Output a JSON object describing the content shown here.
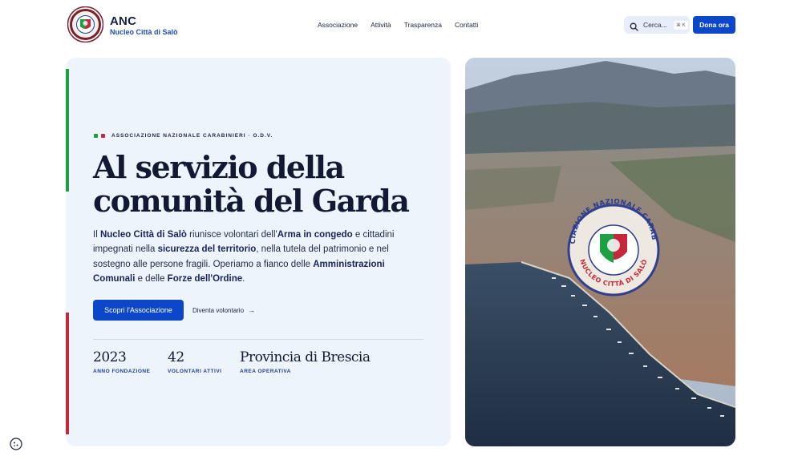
{
  "header": {
    "brand_title": "ANC",
    "brand_subtitle": "Nucleo Città di Salò",
    "nav": [
      "Associazione",
      "Attività",
      "Trasparenza",
      "Contatti"
    ],
    "search_placeholder": "Cerca...",
    "search_shortcut": "⌘ K",
    "donate_label": "Dona ora"
  },
  "hero": {
    "eyebrow": "ASSOCIAZIONE NAZIONALE CARABINIERI · O.D.V.",
    "headline_line1": "Al servizio della",
    "headline_line2": "comunità del Garda",
    "body": {
      "t1": "Il ",
      "b1": "Nucleo Città di Salò",
      "t2": " riunisce volontari dell'",
      "b2": "Arma in congedo",
      "t3": " e cittadini impegnati nella ",
      "b3": "sicurezza del territorio",
      "t4": ", nella tutela del patrimonio e nel sostegno alle persone fragili. Operiamo a fianco delle ",
      "b4": "Amministrazioni Comunali",
      "t5": " e delle ",
      "b5": "Forze dell'Ordine",
      "t6": "."
    },
    "primary_cta": "Scopri l'Associazione",
    "secondary_cta": "Diventa volontario",
    "stats": [
      {
        "value": "2023",
        "label": "ANNO FONDAZIONE"
      },
      {
        "value": "42",
        "label": "VOLONTARI ATTIVI"
      },
      {
        "value": "Provincia di Brescia",
        "label": "AREA OPERATIVA"
      }
    ]
  },
  "photo": {
    "seal_top": "ASSOCIAZIONE NAZIONALE CARABINIERI",
    "seal_bottom": "NUCLEO CITTÀ DI SALÒ"
  },
  "colors": {
    "primary": "#0d47c9",
    "flag_green": "#1e9f46",
    "flag_red": "#c5283a",
    "hero_bg": "#eef4fc"
  }
}
